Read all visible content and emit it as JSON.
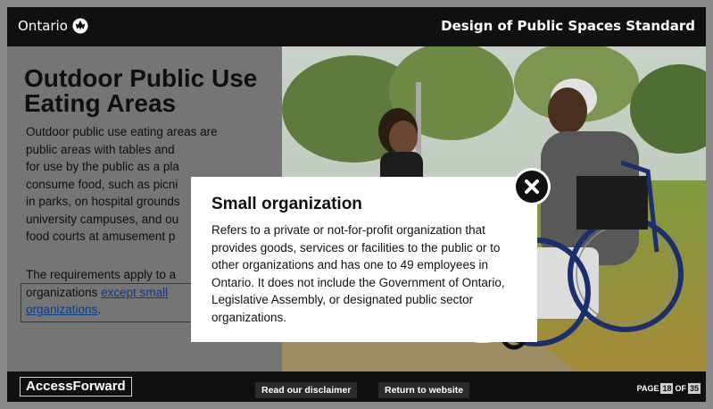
{
  "header": {
    "brand": "Ontario",
    "title": "Design of Public Spaces Standard"
  },
  "page": {
    "title": "Outdoor Public Use Eating Areas",
    "paragraph1": "Outdoor public use eating areas are\npublic areas with tables and\nfor use by the public as a pla\nconsume food, such as picni\nin parks, on hospital grounds\nuniversity campuses, and ou\nfood courts at amusement p",
    "paragraph2_prefix": "The requirements apply to a",
    "paragraph2_line2": "organizations ",
    "link_text_1": "except small",
    "link_text_2": "organizations",
    "period": "."
  },
  "modal": {
    "title": "Small organization",
    "text": "Refers to a private or not-for-profit organization that provides goods, services or facilities to the public or to other organizations and has one to 49 employees in Ontario. It does not include the Government of Ontario, Legislative Assembly, or designated public sector organizations."
  },
  "footer": {
    "logo": "AccessForward",
    "disclaimer_label": "Read our disclaimer",
    "return_label": "Return to website",
    "page_label": "PAGE",
    "current_page": "18",
    "of_label": "OF",
    "total_pages": "35"
  },
  "icons": {
    "close": "close-icon",
    "trillium": "trillium-icon"
  }
}
